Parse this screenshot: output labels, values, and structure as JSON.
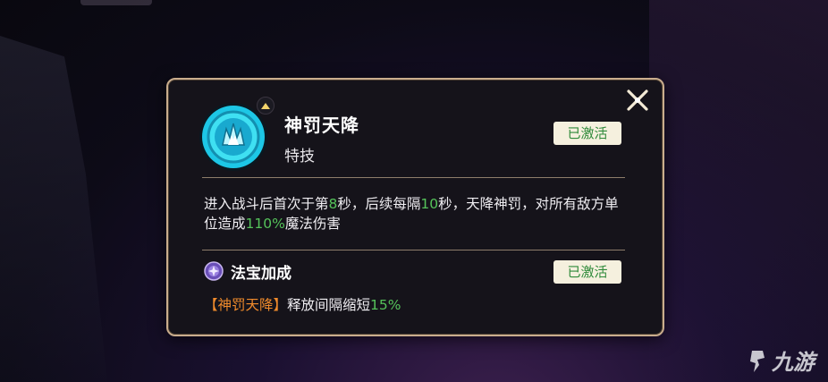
{
  "skill": {
    "name": "神罚天降",
    "type": "特技",
    "status": "已激活",
    "icon": "lightning-burst-icon",
    "badge_icon": "upgrade-arrow-icon"
  },
  "description": {
    "part1": "进入战斗后首次于第",
    "value1": "8",
    "part2": "秒，后续每隔",
    "value2": "10",
    "part3": "秒，天降神罚，对所有敌方单位造成",
    "value3": "110%",
    "part4": "魔法伤害"
  },
  "fabao": {
    "title": "法宝加成",
    "status": "已激活",
    "icon": "treasure-orb-icon",
    "effect_target": "【神罚天降】",
    "effect_text": "释放间隔缩短",
    "effect_value": "15%"
  },
  "close_icon": "close-icon",
  "watermark": {
    "text": "九游",
    "icon": "jiuyou-logo-icon"
  },
  "colors": {
    "highlight_green": "#55c25a",
    "highlight_orange": "#f08b2c",
    "panel_border": "#c9ad8d",
    "tag_bg": "#f5f0de"
  }
}
